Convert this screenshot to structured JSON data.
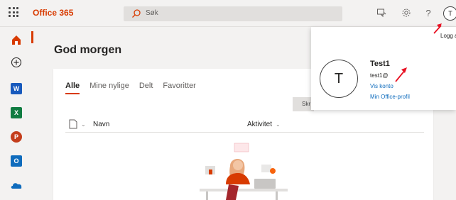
{
  "header": {
    "brand": "Office 365",
    "search_placeholder": "Søk",
    "help_label": "?",
    "avatar_initial": "T"
  },
  "rail": {
    "items": [
      {
        "name": "home",
        "color": "#d83b01"
      },
      {
        "name": "add",
        "color": "#252423"
      },
      {
        "name": "word",
        "color": "#185abd"
      },
      {
        "name": "excel",
        "color": "#107c41"
      },
      {
        "name": "powerpoint",
        "color": "#c43e1c"
      },
      {
        "name": "outlook",
        "color": "#0f6cbd"
      },
      {
        "name": "onedrive",
        "color": "#0f6cbd"
      }
    ]
  },
  "main": {
    "greeting": "God morgen",
    "tabs": [
      "Alle",
      "Mine nylige",
      "Delt",
      "Favoritter"
    ],
    "card_button": "Skr",
    "columns": {
      "name": "Navn",
      "activity": "Aktivitet"
    }
  },
  "account": {
    "logout": "Logg av",
    "initial": "T",
    "name": "Test1",
    "email": "test1@",
    "view_account": "Vis konto",
    "office_profile": "Min Office-profil"
  },
  "colors": {
    "accent": "#d83b01",
    "link": "#0f6cbd",
    "annotation_arrow": "#e81123"
  }
}
